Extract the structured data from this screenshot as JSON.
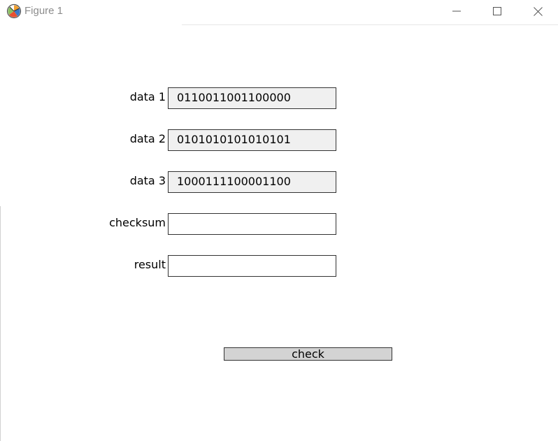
{
  "window": {
    "title": "Figure 1",
    "app_icon": "matplotlib-icon",
    "controls": {
      "minimize_icon": "minimize-icon",
      "maximize_icon": "maximize-icon",
      "close_icon": "close-icon"
    }
  },
  "form": {
    "fields": [
      {
        "label": "data 1",
        "value": "0110011001100000"
      },
      {
        "label": "data 2",
        "value": "0101010101010101"
      },
      {
        "label": "data 3",
        "value": "1000111100001100"
      },
      {
        "label": "checksum",
        "value": ""
      },
      {
        "label": "result",
        "value": ""
      }
    ],
    "check_button_label": "check"
  },
  "colors": {
    "filled_box": "#f0f0f0",
    "empty_box": "#ffffff",
    "button": "#d3d3d3",
    "border": "#333333",
    "title_text": "#8c8c8c"
  }
}
